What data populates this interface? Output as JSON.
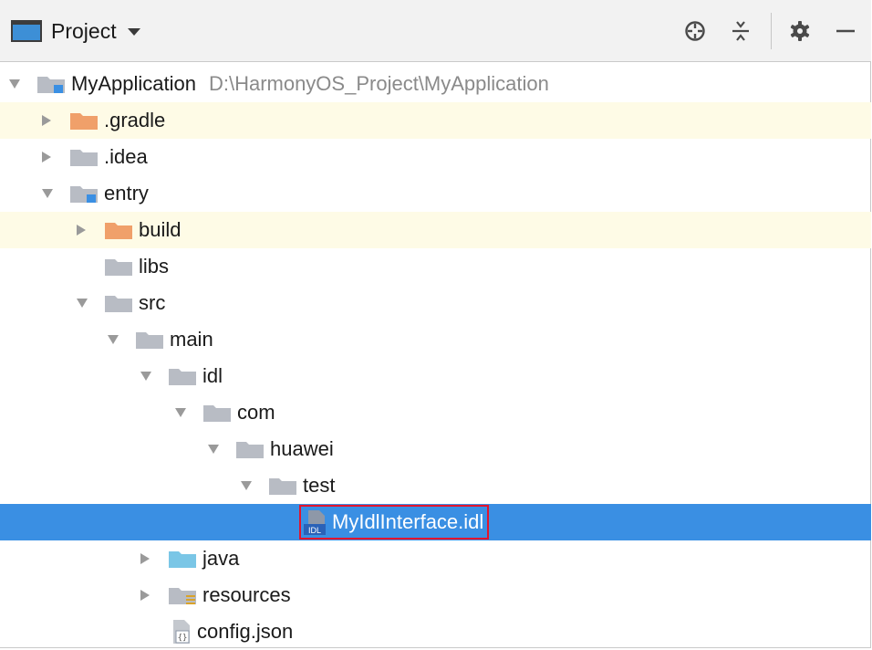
{
  "toolbar": {
    "view_label": "Project",
    "icons": [
      "locate-icon",
      "collapse-all-icon",
      "gear-icon",
      "minimize-icon"
    ]
  },
  "colors": {
    "selection": "#3a8fe3",
    "highlight_row": "#fefbe6",
    "excluded_folder": "#f0a06a",
    "folder": "#b8bcc4",
    "source_folder": "#7ac6e6",
    "selection_border": "#e2142d"
  },
  "tree": {
    "root": {
      "name": "MyApplication",
      "path": "D:\\HarmonyOS_Project\\MyApplication"
    },
    "gradle": ".gradle",
    "idea": ".idea",
    "entry": "entry",
    "build": "build",
    "libs": "libs",
    "src": "src",
    "main": "main",
    "idl": "idl",
    "com": "com",
    "huawei": "huawei",
    "test": "test",
    "idl_file": "MyIdlInterface.idl",
    "idl_badge": "IDL",
    "java": "java",
    "resources": "resources",
    "config": "config.json"
  }
}
